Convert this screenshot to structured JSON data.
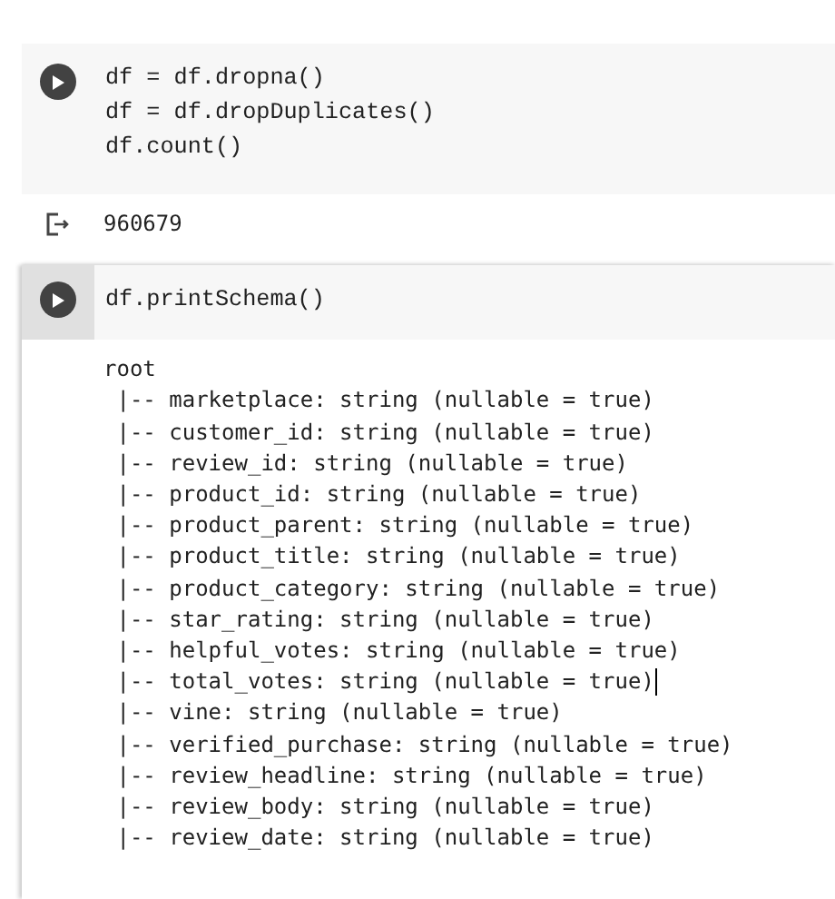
{
  "cells": [
    {
      "focused": false,
      "code": [
        "df = df.dropna()",
        "df = df.dropDuplicates()",
        "df.count()"
      ],
      "output_icon": true,
      "output": [
        {
          "text": "960679",
          "cursor": false
        }
      ]
    },
    {
      "focused": true,
      "code": [
        "df.printSchema()"
      ],
      "output_icon": false,
      "output": [
        {
          "text": "root",
          "cursor": false
        },
        {
          "text": " |-- marketplace: string (nullable = true)",
          "cursor": false
        },
        {
          "text": " |-- customer_id: string (nullable = true)",
          "cursor": false
        },
        {
          "text": " |-- review_id: string (nullable = true)",
          "cursor": false
        },
        {
          "text": " |-- product_id: string (nullable = true)",
          "cursor": false
        },
        {
          "text": " |-- product_parent: string (nullable = true)",
          "cursor": false
        },
        {
          "text": " |-- product_title: string (nullable = true)",
          "cursor": false
        },
        {
          "text": " |-- product_category: string (nullable = true)",
          "cursor": false
        },
        {
          "text": " |-- star_rating: string (nullable = true)",
          "cursor": false
        },
        {
          "text": " |-- helpful_votes: string (nullable = true)",
          "cursor": false
        },
        {
          "text": " |-- total_votes: string (nullable = true)",
          "cursor": true
        },
        {
          "text": " |-- vine: string (nullable = true)",
          "cursor": false
        },
        {
          "text": " |-- verified_purchase: string (nullable = true)",
          "cursor": false
        },
        {
          "text": " |-- review_headline: string (nullable = true)",
          "cursor": false
        },
        {
          "text": " |-- review_body: string (nullable = true)",
          "cursor": false
        },
        {
          "text": " |-- review_date: string (nullable = true)",
          "cursor": false
        }
      ]
    }
  ]
}
